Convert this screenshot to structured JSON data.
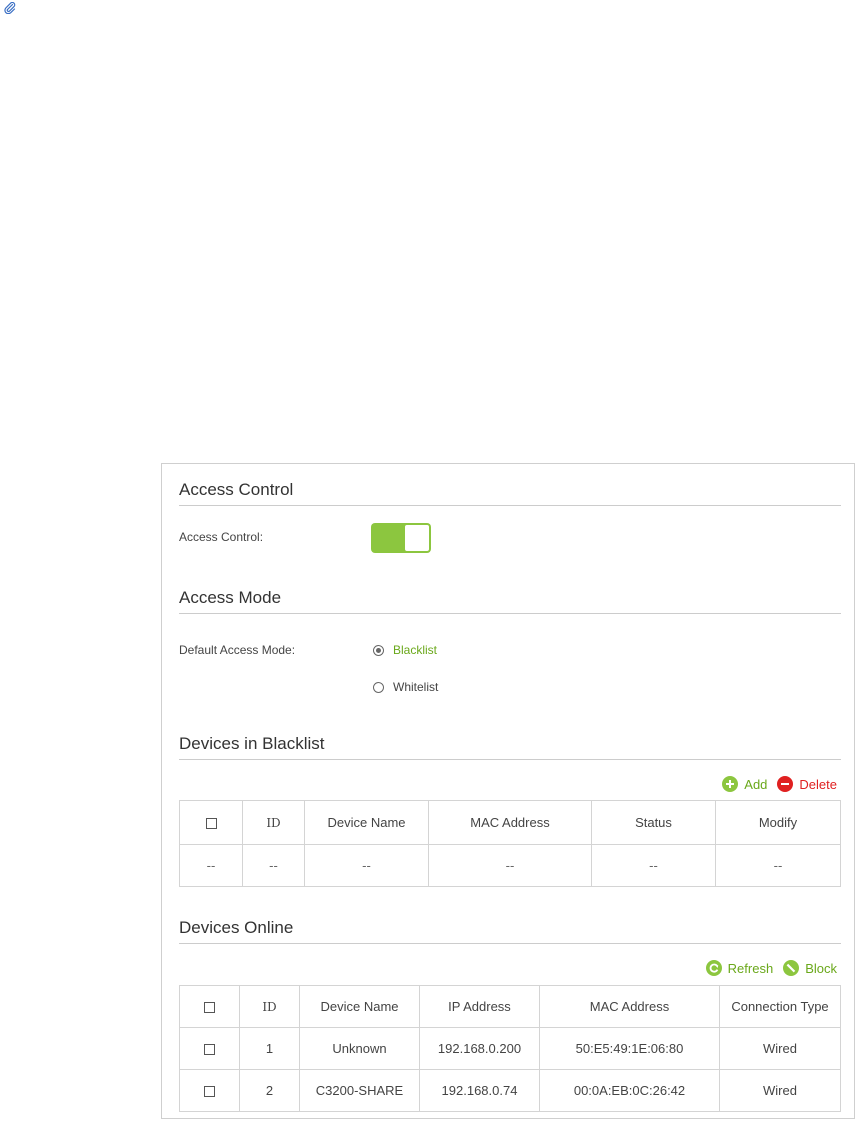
{
  "colors": {
    "accent": "#8cc63f",
    "active_text": "#6aa81a",
    "danger": "#e02020",
    "border": "#d4d4d4"
  },
  "attachment_icon": "paperclip-icon",
  "access_control": {
    "section_title": "Access Control",
    "label": "Access Control:",
    "enabled": true
  },
  "access_mode": {
    "section_title": "Access Mode",
    "label": "Default Access Mode:",
    "options": [
      {
        "label": "Blacklist",
        "selected": true
      },
      {
        "label": "Whitelist",
        "selected": false
      }
    ]
  },
  "blacklist": {
    "section_title": "Devices in Blacklist",
    "add_label": "Add",
    "delete_label": "Delete",
    "columns": [
      "ID",
      "Device Name",
      "MAC Address",
      "Status",
      "Modify"
    ],
    "rows": [
      {
        "id": "--",
        "device_name": "--",
        "mac": "--",
        "status": "--",
        "modify": "--",
        "check": "--"
      }
    ]
  },
  "online": {
    "section_title": "Devices Online",
    "refresh_label": "Refresh",
    "block_label": "Block",
    "columns": [
      "ID",
      "Device Name",
      "IP Address",
      "MAC Address",
      "Connection Type"
    ],
    "rows": [
      {
        "id": "1",
        "device_name": "Unknown",
        "ip": "192.168.0.200",
        "mac": "50:E5:49:1E:06:80",
        "type": "Wired"
      },
      {
        "id": "2",
        "device_name": "C3200-SHARE",
        "ip": "192.168.0.74",
        "mac": "00:0A:EB:0C:26:42",
        "type": "Wired"
      }
    ]
  }
}
